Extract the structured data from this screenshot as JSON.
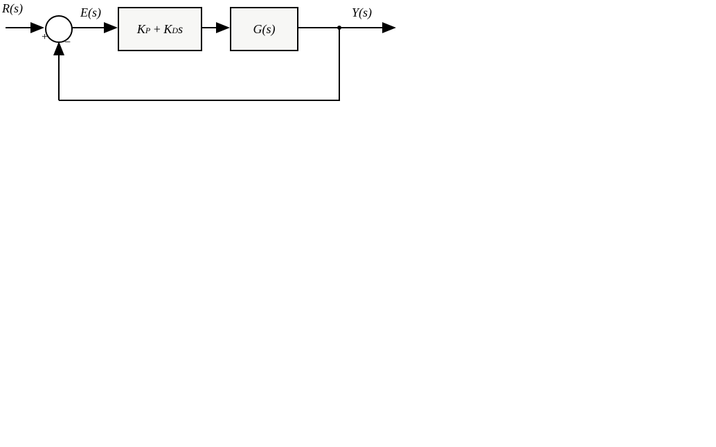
{
  "labels": {
    "input": "R(s)",
    "error": "E(s)",
    "output": "Y(s)"
  },
  "blocks": {
    "controller": "K_P + K_D s",
    "plant": "G(s)"
  },
  "summer": {
    "plus": "+",
    "minus": "−"
  }
}
